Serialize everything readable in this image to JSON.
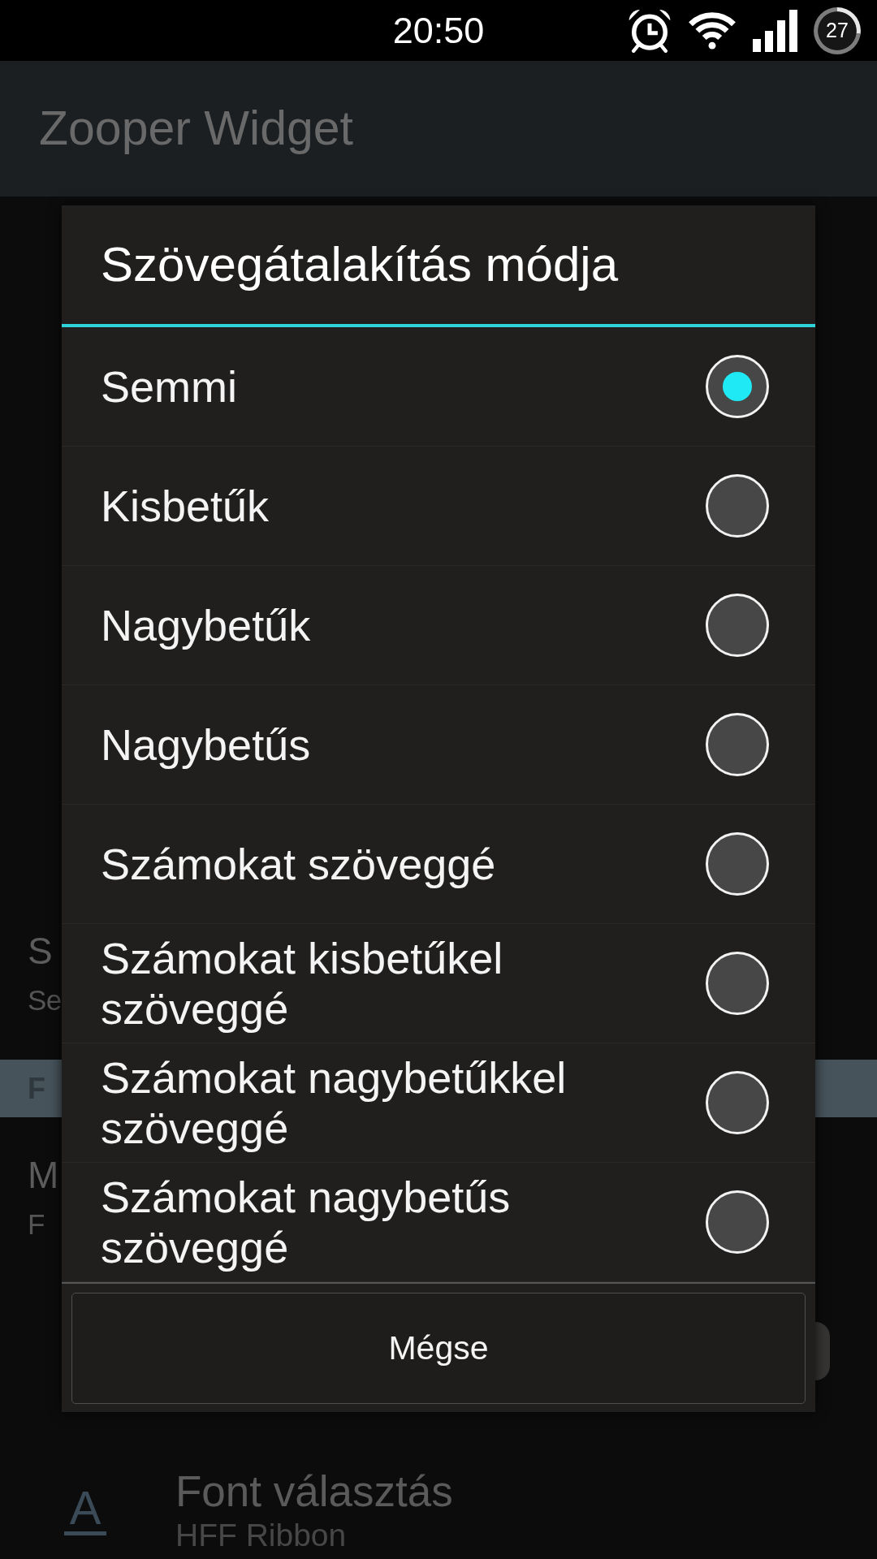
{
  "status_bar": {
    "time": "20:50",
    "battery": "27"
  },
  "app_bar": {
    "title": "Zooper Widget"
  },
  "background_list": [
    {
      "kind": "setting",
      "title": "S",
      "summary": "Se"
    },
    {
      "kind": "header",
      "title": "F"
    },
    {
      "kind": "setting",
      "title": "M",
      "summary": "F"
    },
    {
      "kind": "icon_setting",
      "icon": "A",
      "title": "Font választás",
      "summary": "HFF Ribbon"
    }
  ],
  "dialog": {
    "title": "Szövegátalakítás módja",
    "options": [
      {
        "label": "Semmi",
        "selected": true
      },
      {
        "label": "Kisbetűk",
        "selected": false
      },
      {
        "label": "Nagybetűk",
        "selected": false
      },
      {
        "label": "Nagybetűs",
        "selected": false
      },
      {
        "label": "Számokat szöveggé",
        "selected": false
      },
      {
        "label": "Számokat kisbetűkel szöveggé",
        "selected": false
      },
      {
        "label": "Számokat nagybetűkkel szöveggé",
        "selected": false
      },
      {
        "label": "Számokat nagybetűs szöveggé",
        "selected": false
      }
    ],
    "buttons": [
      "Mégse"
    ]
  }
}
